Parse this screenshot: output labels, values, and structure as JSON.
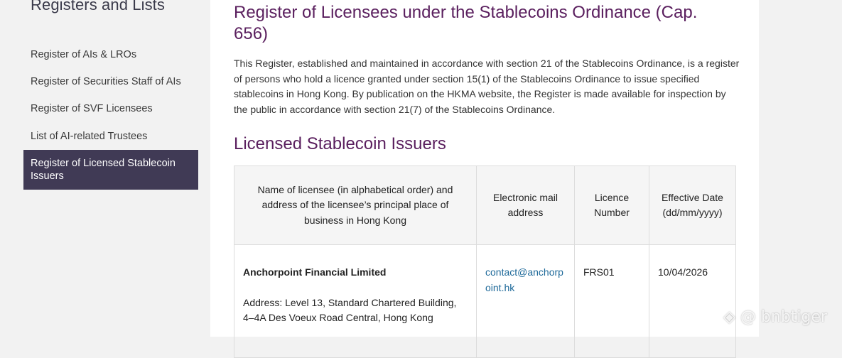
{
  "sidebar": {
    "heading": "Registers and Lists",
    "items": [
      {
        "label": "Register of AIs & LROs"
      },
      {
        "label": "Register of Securities Staff of AIs"
      },
      {
        "label": "Register of SVF Licensees"
      },
      {
        "label": "List of AI-related Trustees"
      },
      {
        "label": "Register of Licensed Stablecoin Issuers",
        "active": true
      }
    ]
  },
  "main": {
    "title": "Register of Licensees under the Stablecoins Ordinance (Cap. 656)",
    "intro": "This Register, established and maintained in accordance with section 21 of the Stablecoins Ordinance, is a register of persons who hold a licence granted under section 15(1) of the Stablecoins Ordinance to issue specified stablecoins in Hong Kong. By publication on the HKMA website, the Register is made available for inspection by the public in accordance with section 21(7) of the Stablecoins Ordinance.",
    "section_title": "Licensed Stablecoin Issuers",
    "table": {
      "headers": [
        "Name of licensee (in alphabetical order) and address of the licensee’s principal place of business in Hong Kong",
        "Electronic mail address",
        "Licence Number",
        "Effective Date (dd/mm/yyyy)"
      ],
      "rows": [
        {
          "name": "Anchorpoint Financial Limited",
          "address": "Address: Level 13, Standard Chartered Building, 4–4A Des Voeux Road Central, Hong Kong",
          "email": "contact@anchorpoint.hk",
          "licence_number": "FRS01",
          "effective_date": "10/04/2026"
        }
      ]
    }
  },
  "watermark": {
    "text": "@ bnbtiger",
    "icon": "binance-square-icon"
  },
  "colors": {
    "heading_purple": "#5a1f5e",
    "active_nav_bg": "#403a55",
    "link_blue": "#1f6a9a"
  }
}
